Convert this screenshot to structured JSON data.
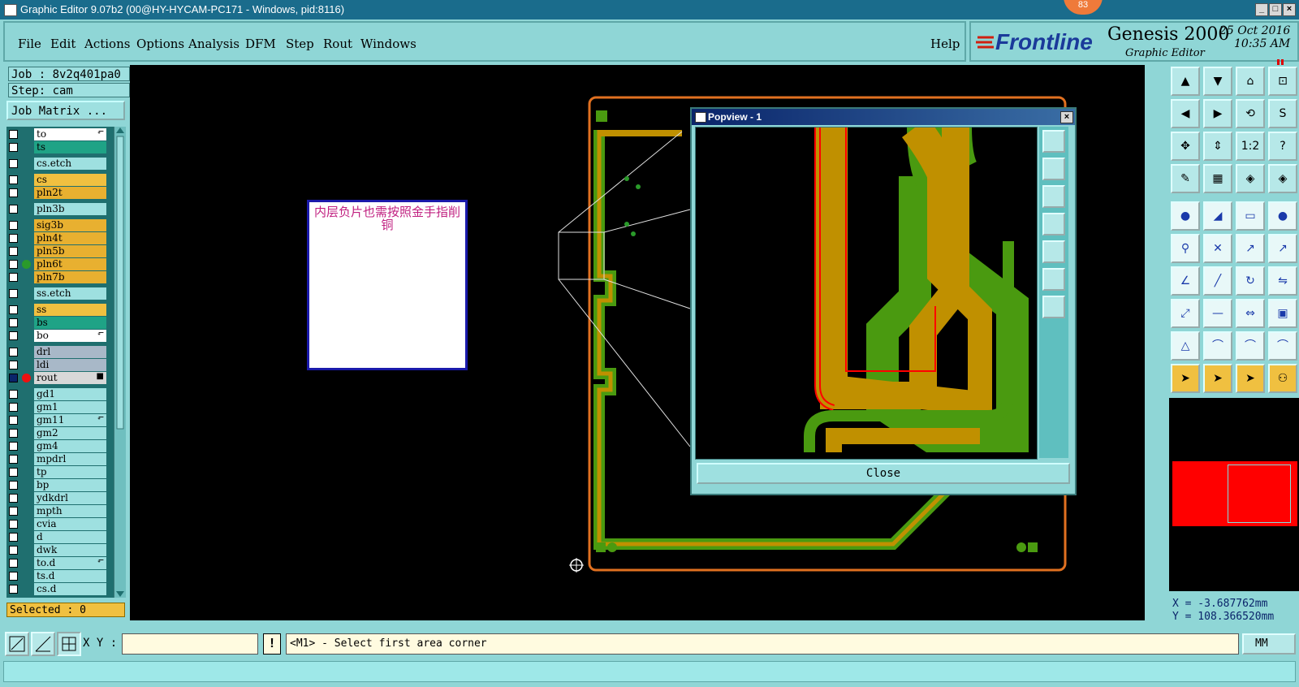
{
  "window": {
    "title": "Graphic Editor 9.07b2 (00@HY-HYCAM-PC171 - Windows, pid:8116)",
    "badge": "83",
    "minimize": "_",
    "maximize": "□",
    "close": "×"
  },
  "menu": {
    "items": [
      "File",
      "Edit",
      "Actions",
      "Options",
      "Analysis",
      "DFM",
      "Step",
      "Rout",
      "Windows"
    ],
    "help": "Help"
  },
  "brand": {
    "logo": "Frontline",
    "product": "Genesis 2000",
    "subtitle": "Graphic Editor",
    "date": "25 Oct 2016",
    "time": "10:35 AM"
  },
  "job": {
    "job_line": "Job : 8v2q401pa0",
    "step_line": "Step: cam",
    "matrix_button": "Job Matrix ..."
  },
  "layers": [
    {
      "name": "to",
      "color": "#ffffff",
      "mark": "⬐"
    },
    {
      "name": "ts",
      "color": "#1fa386"
    },
    {
      "name": "cs.etch",
      "color": "#9ee0e0"
    },
    {
      "name": "cs",
      "color": "#f0c040"
    },
    {
      "name": "pln2t",
      "color": "#e8b030"
    },
    {
      "name": "pln3b",
      "color": "#9ee0e0"
    },
    {
      "name": "sig3b",
      "color": "#e8b030"
    },
    {
      "name": "pln4t",
      "color": "#e8b030"
    },
    {
      "name": "pln5b",
      "color": "#e8b030"
    },
    {
      "name": "pln6t",
      "color": "#e8b030",
      "dot": "#2a9a2a"
    },
    {
      "name": "pln7b",
      "color": "#e8b030"
    },
    {
      "name": "ss.etch",
      "color": "#9ee0e0"
    },
    {
      "name": "ss",
      "color": "#f0c040"
    },
    {
      "name": "bs",
      "color": "#1fa386"
    },
    {
      "name": "bo",
      "color": "#ffffff",
      "mark": "⬐"
    },
    {
      "name": "drl",
      "color": "#a8b8c8"
    },
    {
      "name": "ldi",
      "color": "#a8b8c8"
    },
    {
      "name": "rout",
      "color": "#d8d8d8",
      "dot": "#ee1111",
      "checked": true,
      "mark": "■"
    },
    {
      "name": "gd1",
      "color": "#9ee0e0"
    },
    {
      "name": "gm1",
      "color": "#9ee0e0"
    },
    {
      "name": "gm11",
      "color": "#9ee0e0",
      "mark": "⬐"
    },
    {
      "name": "gm2",
      "color": "#9ee0e0"
    },
    {
      "name": "gm4",
      "color": "#9ee0e0"
    },
    {
      "name": "mpdrl",
      "color": "#9ee0e0"
    },
    {
      "name": "tp",
      "color": "#9ee0e0"
    },
    {
      "name": "bp",
      "color": "#9ee0e0"
    },
    {
      "name": "ydkdrl",
      "color": "#9ee0e0"
    },
    {
      "name": "mpth",
      "color": "#9ee0e0"
    },
    {
      "name": "cvia",
      "color": "#9ee0e0"
    },
    {
      "name": "d",
      "color": "#9ee0e0"
    },
    {
      "name": "dwk",
      "color": "#9ee0e0"
    },
    {
      "name": "to.d",
      "color": "#9ee0e0",
      "mark": "⬐"
    },
    {
      "name": "ts.d",
      "color": "#9ee0e0"
    },
    {
      "name": "cs.d",
      "color": "#9ee0e0"
    }
  ],
  "selected": "Selected : 0",
  "note": {
    "text": "内层负片也需按照金手指削铜"
  },
  "popview": {
    "title": "Popview - 1",
    "close_label": "Close",
    "close_x": "×"
  },
  "coords": {
    "x": "X = -3.687762mm",
    "y": "Y = 108.366520mm"
  },
  "bottom": {
    "xy_label": "X Y :",
    "xy_value": "",
    "warn": "!",
    "prompt": "<M1> - Select first area corner",
    "units": "MM"
  },
  "colors": {
    "board_outline": "#e07020",
    "copper": "#c09000",
    "green": "#4a9a10",
    "red": "#ff0000",
    "canvas": "#000000"
  }
}
